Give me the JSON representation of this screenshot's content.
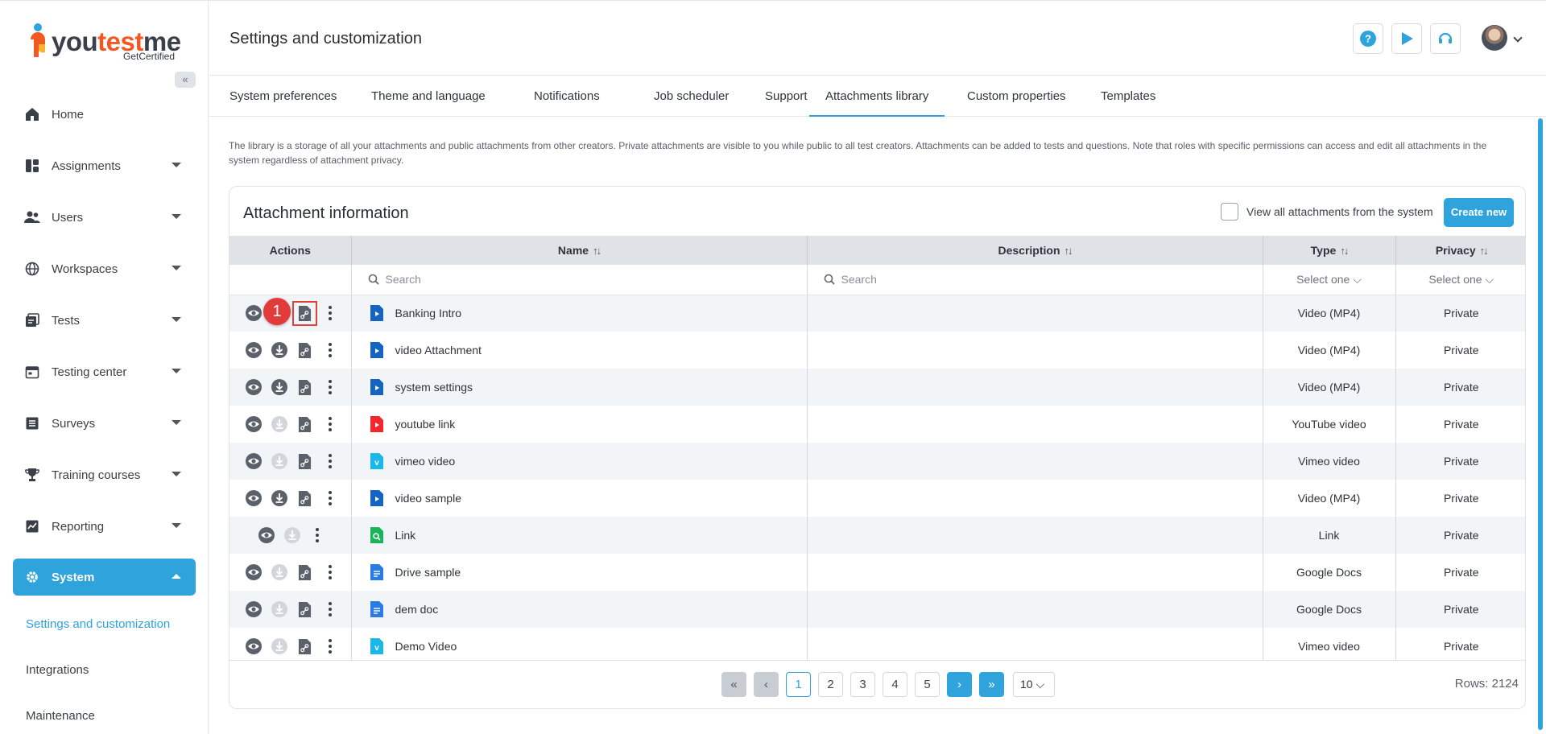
{
  "brand": {
    "name_part1": "you",
    "name_part2": "test",
    "name_part3": "me",
    "sub": "GetCertified",
    "accent": "#2ea3dc"
  },
  "sidebar": {
    "collapse_label": "«",
    "items": [
      {
        "label": "Home",
        "icon": "home-icon"
      },
      {
        "label": "Assignments",
        "icon": "assignments-icon"
      },
      {
        "label": "Users",
        "icon": "users-icon"
      },
      {
        "label": "Workspaces",
        "icon": "globe-icon"
      },
      {
        "label": "Tests",
        "icon": "tests-icon"
      },
      {
        "label": "Testing center",
        "icon": "calendar-icon"
      },
      {
        "label": "Surveys",
        "icon": "list-icon"
      },
      {
        "label": "Training courses",
        "icon": "trophy-icon"
      },
      {
        "label": "Reporting",
        "icon": "chart-icon"
      },
      {
        "label": "System",
        "icon": "gear-icon"
      }
    ],
    "sub_items": [
      "Settings and customization",
      "Integrations",
      "Maintenance"
    ]
  },
  "header": {
    "title": "Settings and customization"
  },
  "tabs": [
    "System preferences",
    "Theme and language",
    "Notifications",
    "Job scheduler",
    "Support",
    "Attachments library",
    "Custom properties",
    "Templates"
  ],
  "description": "The library is a storage of all your attachments and public attachments from other creators. Private attachments are visible to you while public to all test creators. Attachments can be added to tests and questions. Note that roles with specific permissions can access and edit all attachments in the system regardless of attachment privacy.",
  "card": {
    "title": "Attachment information",
    "view_all_label": "View all attachments from the system",
    "create_label": "Create new"
  },
  "table": {
    "columns": [
      "Actions",
      "Name",
      "Description",
      "Type",
      "Privacy"
    ],
    "search_placeholder": "Search",
    "select_placeholder": "Select one",
    "rows": [
      {
        "name": "Banking Intro",
        "type": "Video (MP4)",
        "privacy": "Private",
        "icon": "video-file"
      },
      {
        "name": "video  Attachment",
        "type": "Video (MP4)",
        "privacy": "Private",
        "icon": "video-file"
      },
      {
        "name": "system settings",
        "type": "Video (MP4)",
        "privacy": "Private",
        "icon": "video-file"
      },
      {
        "name": "youtube link",
        "type": "YouTube video",
        "privacy": "Private",
        "icon": "youtube-file"
      },
      {
        "name": "vimeo video",
        "type": "Vimeo video",
        "privacy": "Private",
        "icon": "vimeo-file"
      },
      {
        "name": "video sample",
        "type": "Video (MP4)",
        "privacy": "Private",
        "icon": "video-file"
      },
      {
        "name": "Link",
        "type": "Link",
        "privacy": "Private",
        "icon": "link-file"
      },
      {
        "name": "Drive   sample",
        "type": "Google Docs",
        "privacy": "Private",
        "icon": "docs-file"
      },
      {
        "name": "dem  doc",
        "type": "Google Docs",
        "privacy": "Private",
        "icon": "docs-file"
      },
      {
        "name": "Demo Video",
        "type": "Vimeo video",
        "privacy": "Private",
        "icon": "vimeo-file"
      }
    ]
  },
  "pagination": {
    "pages": [
      "1",
      "2",
      "3",
      "4",
      "5"
    ],
    "page_size": "10",
    "rows_label": "Rows: 2124"
  },
  "marker": "1"
}
